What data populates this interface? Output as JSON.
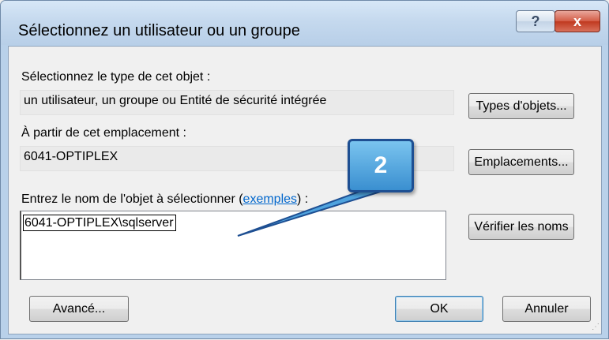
{
  "window": {
    "title": "Sélectionnez un utilisateur ou un groupe",
    "help_label": "?",
    "close_label": "x"
  },
  "object_type": {
    "label": "Sélectionnez le type de cet objet :",
    "value": "un utilisateur, un groupe ou Entité de sécurité intégrée",
    "button": "Types d'objets..."
  },
  "location": {
    "label": "À partir de cet emplacement :",
    "value": "6041-OPTIPLEX",
    "button": "Emplacements..."
  },
  "object_name": {
    "label_prefix": "Entrez le nom de l'objet à sélectionner (",
    "link": "exemples",
    "label_suffix": ") :",
    "value": "6041-OPTIPLEX\\sqlserver",
    "button": "Vérifier les noms"
  },
  "footer": {
    "advanced_button": "Avancé...",
    "ok_button": "OK",
    "cancel_button": "Annuler"
  },
  "callout": {
    "number": "2",
    "color": "#3a8fd0"
  }
}
